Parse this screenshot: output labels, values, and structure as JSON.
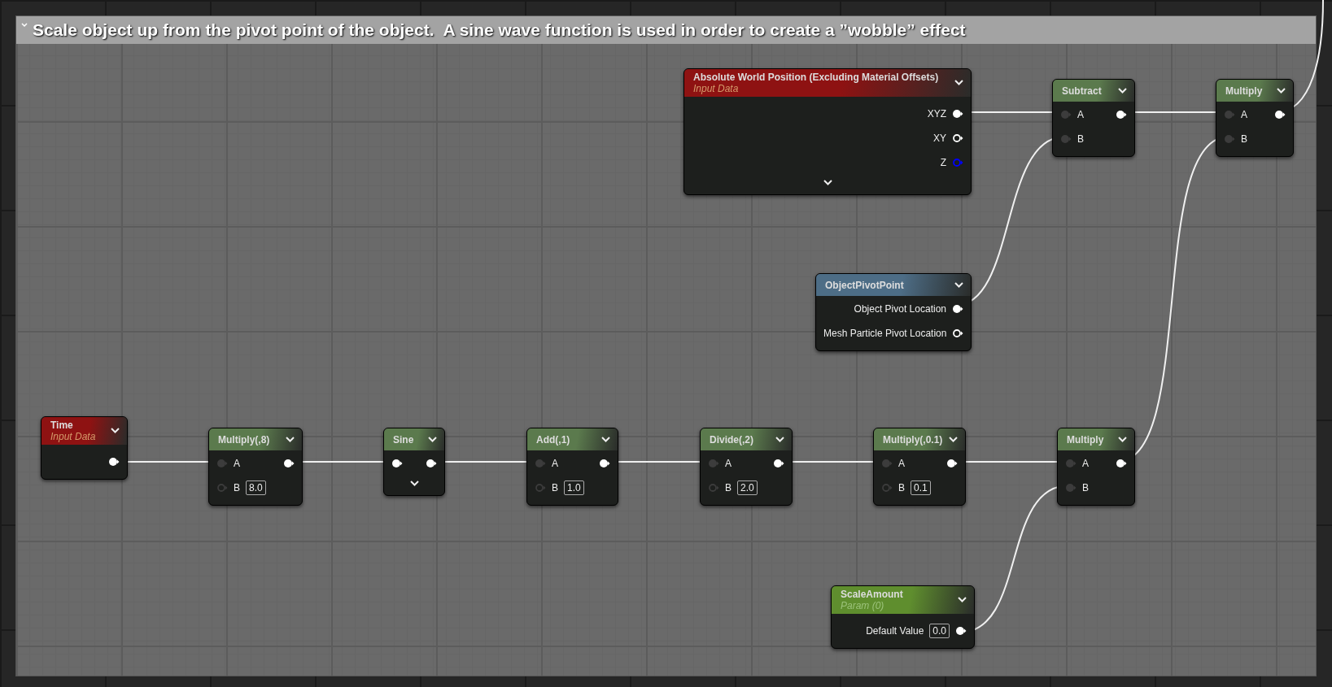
{
  "comment": {
    "text": "Scale object up from the pivot point of the object.  A sine wave function is used in order to create a ”wobble” effect"
  },
  "nodes": [
    {
      "kind": "input",
      "title": "Absolute World Position (Excluding Material Offsets)",
      "subtitle": "Input Data",
      "advanced": true,
      "outputs": [
        {
          "label": "XYZ",
          "filled": true,
          "color": "#ffffff"
        },
        {
          "label": "XY",
          "filled": false,
          "color": "#ffffff"
        },
        {
          "label": "Z",
          "filled": false,
          "color": "#0000ff"
        }
      ]
    },
    {
      "kind": "math",
      "title": "Subtract",
      "advanced": false,
      "inputs": [
        {
          "label": "A",
          "filled": true,
          "color": "#3c3c3c"
        },
        {
          "label": "B",
          "filled": true,
          "color": "#3c3c3c"
        }
      ],
      "outputs": [
        {
          "filled": true,
          "color": "#ffffff"
        }
      ]
    },
    {
      "kind": "math",
      "title": "Multiply",
      "advanced": false,
      "inputs": [
        {
          "label": "A",
          "filled": true,
          "color": "#3c3c3c"
        },
        {
          "label": "B",
          "filled": true,
          "color": "#3c3c3c"
        }
      ],
      "outputs": [
        {
          "filled": true,
          "color": "#ffffff"
        }
      ]
    },
    {
      "kind": "struct",
      "title": "ObjectPivotPoint",
      "advanced": false,
      "outputs": [
        {
          "label": "Object Pivot Location",
          "filled": true,
          "color": "#ffffff"
        },
        {
          "label": "Mesh Particle Pivot Location",
          "filled": false,
          "color": "#ffffff"
        }
      ]
    },
    {
      "kind": "input",
      "title": "Time",
      "subtitle": "Input Data",
      "advanced": false,
      "outputs": [
        {
          "filled": true,
          "color": "#ffffff"
        }
      ]
    },
    {
      "kind": "math",
      "title": "Multiply(,8)",
      "advanced": false,
      "inputs": [
        {
          "label": "A",
          "filled": true,
          "color": "#3c3c3c"
        },
        {
          "label": "B",
          "value": "8.0",
          "filled": false,
          "color": "#3c3c3c"
        }
      ],
      "outputs": [
        {
          "filled": true,
          "color": "#ffffff"
        }
      ]
    },
    {
      "kind": "math",
      "title": "Sine",
      "advanced": true,
      "inputs": [
        {
          "filled": true,
          "color": "#ffffff"
        }
      ],
      "outputs": [
        {
          "filled": true,
          "color": "#ffffff"
        }
      ]
    },
    {
      "kind": "math",
      "title": "Add(,1)",
      "advanced": false,
      "inputs": [
        {
          "label": "A",
          "filled": true,
          "color": "#3c3c3c"
        },
        {
          "label": "B",
          "value": "1.0",
          "filled": false,
          "color": "#3c3c3c"
        }
      ],
      "outputs": [
        {
          "filled": true,
          "color": "#ffffff"
        }
      ]
    },
    {
      "kind": "math",
      "title": "Divide(,2)",
      "advanced": false,
      "inputs": [
        {
          "label": "A",
          "filled": true,
          "color": "#3c3c3c"
        },
        {
          "label": "B",
          "value": "2.0",
          "filled": false,
          "color": "#3c3c3c"
        }
      ],
      "outputs": [
        {
          "filled": true,
          "color": "#ffffff"
        }
      ]
    },
    {
      "kind": "math",
      "title": "Multiply(,0.1)",
      "advanced": false,
      "inputs": [
        {
          "label": "A",
          "filled": true,
          "color": "#3c3c3c"
        },
        {
          "label": "B",
          "value": "0.1",
          "filled": false,
          "color": "#3c3c3c"
        }
      ],
      "outputs": [
        {
          "filled": true,
          "color": "#ffffff"
        }
      ]
    },
    {
      "kind": "math",
      "title": "Multiply",
      "advanced": false,
      "inputs": [
        {
          "label": "A",
          "filled": true,
          "color": "#3c3c3c"
        },
        {
          "label": "B",
          "filled": true,
          "color": "#3c3c3c"
        }
      ],
      "outputs": [
        {
          "filled": true,
          "color": "#ffffff"
        }
      ]
    },
    {
      "kind": "param",
      "title": "ScaleAmount",
      "subtitle": "Param (0)",
      "advanced": false,
      "outputs": [
        {
          "label": "Default Value",
          "value": "0.0",
          "filled": true,
          "color": "#ffffff"
        }
      ]
    }
  ]
}
